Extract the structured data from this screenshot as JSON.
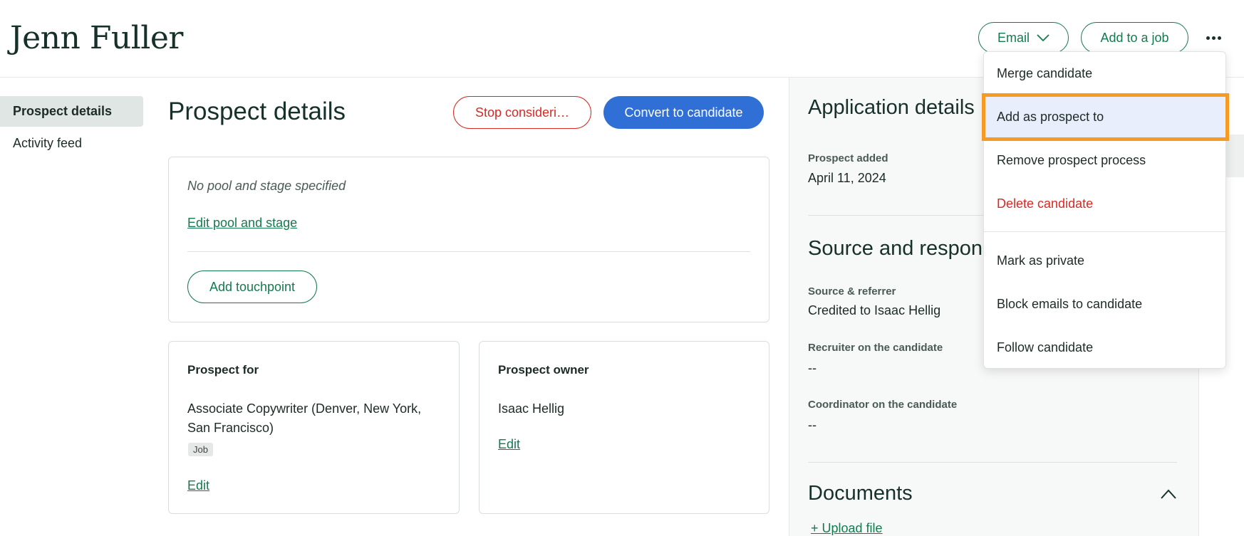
{
  "header": {
    "name": "Jenn Fuller",
    "email_label": "Email",
    "add_job_label": "Add to a job"
  },
  "nav": {
    "items": [
      {
        "label": "Prospect details"
      },
      {
        "label": "Activity feed"
      }
    ]
  },
  "main": {
    "title": "Prospect details",
    "stop_label": "Stop consideri…",
    "convert_label": "Convert to candidate",
    "pool": {
      "text": "No pool and stage specified",
      "edit_label": "Edit pool and stage",
      "touchpoint_label": "Add touchpoint"
    },
    "prospect_for": {
      "heading": "Prospect for",
      "value": "Associate Copywriter (Denver, New York, San Francisco)",
      "badge": "Job",
      "edit_label": "Edit"
    },
    "prospect_owner": {
      "heading": "Prospect owner",
      "value": "Isaac Hellig",
      "edit_label": "Edit"
    }
  },
  "application": {
    "title": "Application details",
    "prospect_added_label": "Prospect added",
    "prospect_added_value": "April 11, 2024",
    "source_title": "Source and responsi",
    "source_label": "Source & referrer",
    "source_value": "Credited to Isaac Hellig",
    "recruiter_label": "Recruiter on the candidate",
    "recruiter_value": "--",
    "coordinator_label": "Coordinator on the candidate",
    "coordinator_value": "--",
    "documents_title": "Documents",
    "upload_label": "+ Upload file"
  },
  "menu": {
    "items": [
      {
        "label": "Merge candidate"
      },
      {
        "label": "Add as prospect to"
      },
      {
        "label": "Remove prospect process"
      },
      {
        "label": "Delete candidate"
      },
      {
        "label": "Mark as private"
      },
      {
        "label": "Block emails to candidate"
      },
      {
        "label": "Follow candidate"
      }
    ]
  },
  "colors": {
    "brand_green": "#157a4e",
    "primary_blue": "#2f6fd6",
    "danger_red": "#d62a24",
    "highlight_orange": "#f59a23"
  }
}
